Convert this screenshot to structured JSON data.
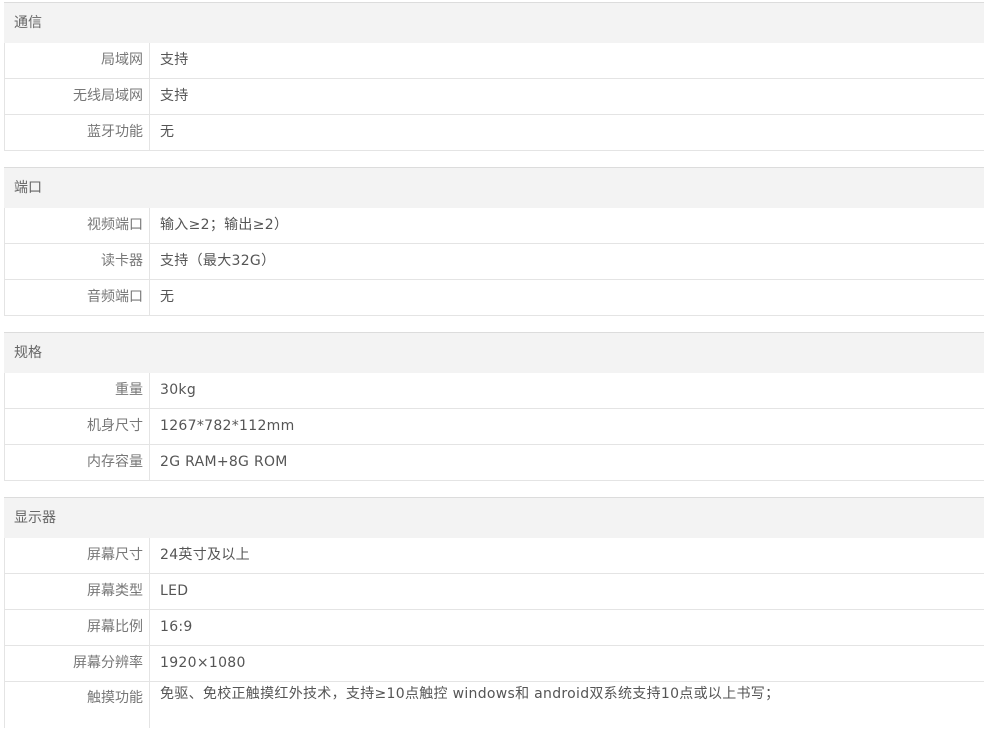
{
  "sections": [
    {
      "title": "通信",
      "rows": [
        {
          "label": "局域网",
          "value": "支持"
        },
        {
          "label": "无线局域网",
          "value": "支持"
        },
        {
          "label": "蓝牙功能",
          "value": "无"
        }
      ]
    },
    {
      "title": "端口",
      "rows": [
        {
          "label": "视频端口",
          "value": "输入≥2；输出≥2）"
        },
        {
          "label": "读卡器",
          "value": "支持（最大32G）"
        },
        {
          "label": "音频端口",
          "value": "无"
        }
      ]
    },
    {
      "title": "规格",
      "rows": [
        {
          "label": "重量",
          "value": "30kg"
        },
        {
          "label": "机身尺寸",
          "value": "1267*782*112mm"
        },
        {
          "label": "内存容量",
          "value": "2G RAM+8G ROM"
        }
      ]
    },
    {
      "title": "显示器",
      "rows": [
        {
          "label": "屏幕尺寸",
          "value": "24英寸及以上"
        },
        {
          "label": "屏幕类型",
          "value": "LED"
        },
        {
          "label": "屏幕比例",
          "value": "16:9"
        },
        {
          "label": "屏幕分辨率",
          "value": "1920×1080"
        },
        {
          "label": "触摸功能",
          "value": "免驱、免校正触摸红外技术，支持≥10点触控 windows和 android双系统支持10点或以上书写；"
        }
      ]
    }
  ]
}
